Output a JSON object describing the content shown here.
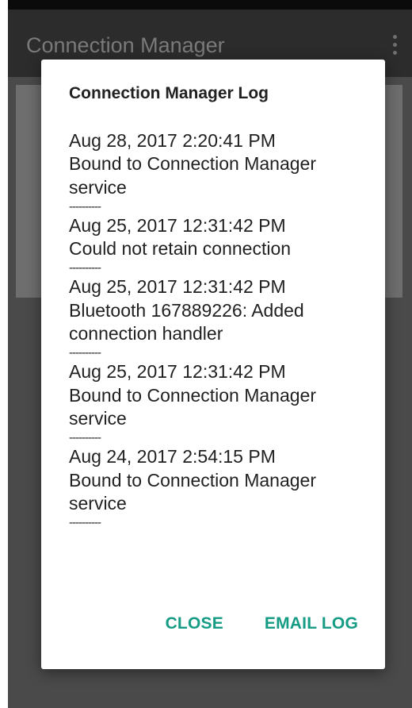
{
  "app_bar": {
    "title": "Connection Manager"
  },
  "dialog": {
    "title": "Connection Manager Log",
    "separator": "----------",
    "entries": [
      {
        "timestamp": "Aug 28, 2017 2:20:41 PM",
        "message": "Bound to Connection Manager service"
      },
      {
        "timestamp": "Aug 25, 2017 12:31:42 PM",
        "message": "Could not retain connection"
      },
      {
        "timestamp": "Aug 25, 2017 12:31:42 PM",
        "message": "Bluetooth 167889226: Added connection handler"
      },
      {
        "timestamp": "Aug 25, 2017 12:31:42 PM",
        "message": "Bound to Connection Manager service"
      },
      {
        "timestamp": "Aug 24, 2017 2:54:15 PM",
        "message": "Bound to Connection Manager service"
      }
    ],
    "close_label": "CLOSE",
    "email_label": "EMAIL LOG"
  },
  "colors": {
    "accent": "#169c84",
    "app_bar": "#2c2c2c",
    "scrim_background": "#4a4a4a"
  },
  "icons": {
    "overflow": "more-vert-icon"
  }
}
